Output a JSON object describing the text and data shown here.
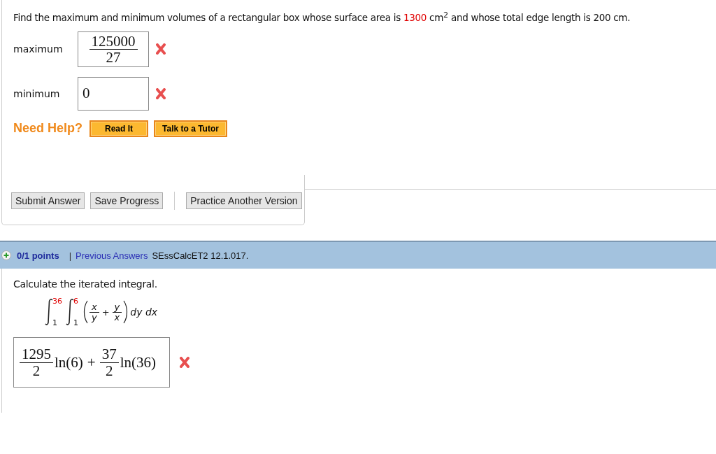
{
  "question_1": {
    "prompt": [
      {
        "kind": "plain",
        "text": "Find the maximum and minimum volumes of a rectangular box whose surface area is"
      },
      {
        "kind": "highlight",
        "text": "1300"
      },
      {
        "kind": "plain",
        "text": "cm$^{2}$ and whose total edge length is 200 cm."
      }
    ],
    "answers": [
      {
        "label": "maximum",
        "correct": false,
        "value": {
          "kind": "fraction",
          "numerator": "125000",
          "denominator": "27"
        }
      },
      {
        "label": "minimum",
        "correct": false,
        "value": {
          "kind": "text",
          "text": "0"
        }
      }
    ],
    "help": {
      "title": "Need Help?",
      "buttons": [
        "Read It",
        "Talk to a Tutor"
      ]
    },
    "actions": [
      "Submit Answer",
      "Save Progress",
      "Practice Another Version"
    ]
  },
  "question_2": {
    "header": {
      "points": "0/1 points",
      "separator": "|",
      "link": "Previous Answers",
      "code": "SEssCalcET2 12.1.017."
    },
    "prompt": "Calculate the iterated integral.",
    "integral": {
      "outer": {
        "upper": "36",
        "lower": "1",
        "highlight": true
      },
      "inner": {
        "upper": "6",
        "lower": "1",
        "highlight": true
      },
      "terms": [
        {
          "numerator": "x",
          "denominator": "y"
        },
        {
          "numerator": "y",
          "denominator": "x"
        }
      ],
      "operator": "+",
      "differentials": "dy dx"
    },
    "answer": {
      "correct": false,
      "terms": [
        {
          "kind": "fraction",
          "numerator": "1295",
          "denominator": "2"
        },
        {
          "kind": "text",
          "text": "ln(6)"
        },
        {
          "kind": "op",
          "text": "+"
        },
        {
          "kind": "fraction",
          "numerator": "37",
          "denominator": "2"
        },
        {
          "kind": "text",
          "text": "ln(36)"
        }
      ]
    }
  }
}
